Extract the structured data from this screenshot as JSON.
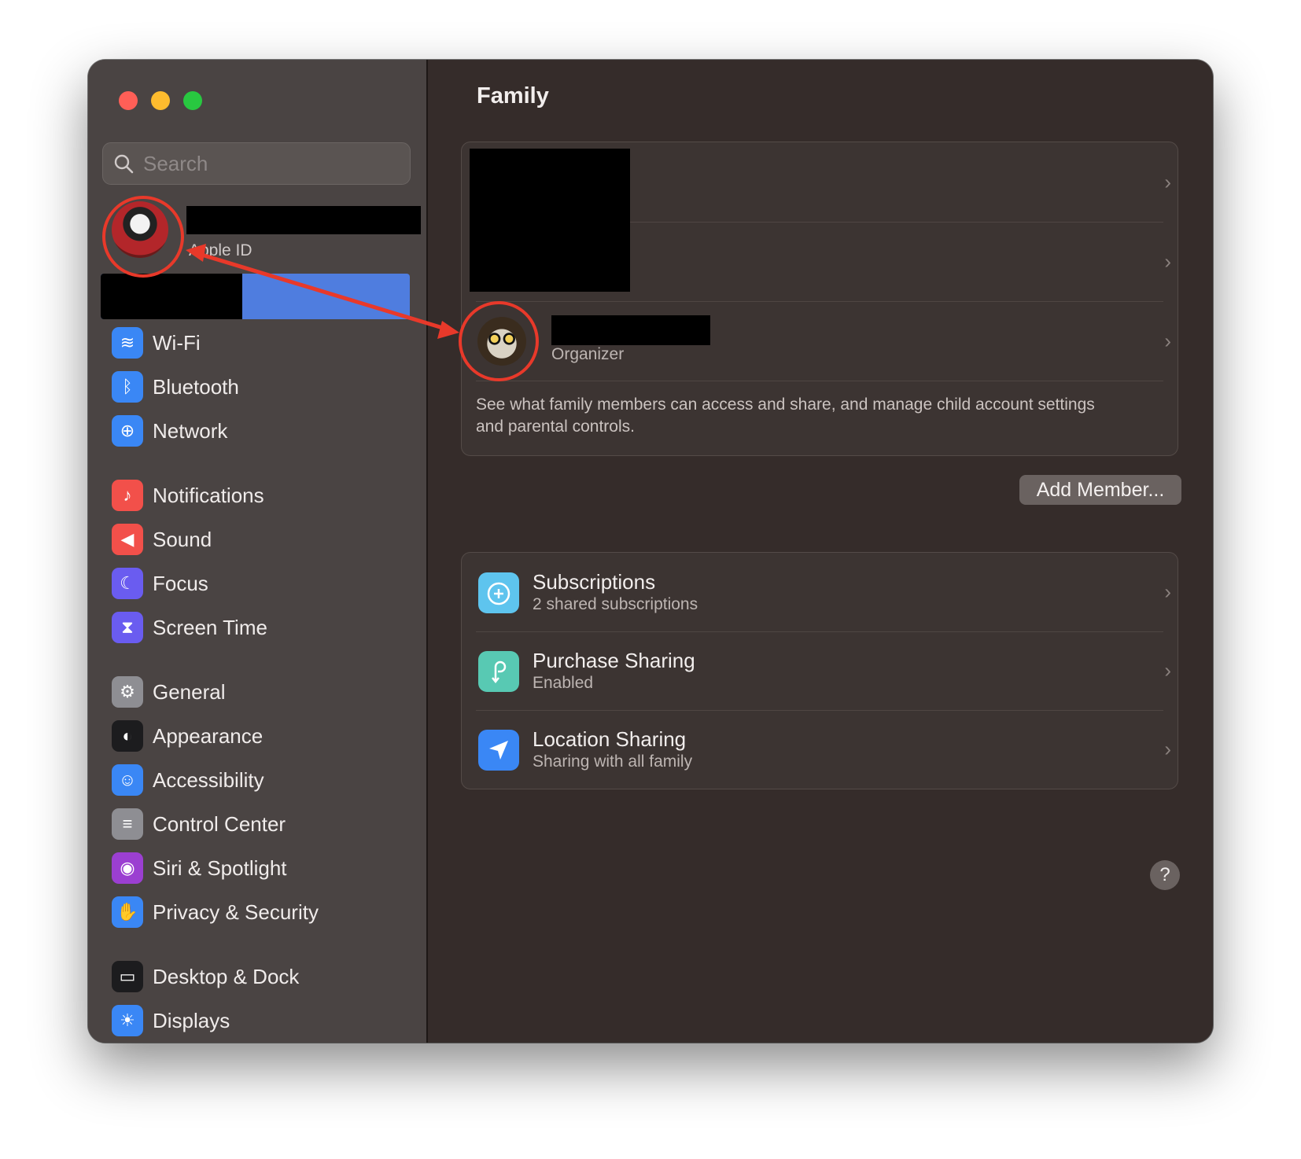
{
  "window": {
    "traffic_lights": [
      "close",
      "minimize",
      "maximize"
    ]
  },
  "search": {
    "placeholder": "Search"
  },
  "account": {
    "subtitle": "Apple ID"
  },
  "sidebar": {
    "items": [
      {
        "label": "Wi-Fi",
        "icon": "wifi-icon",
        "color": "#3a87f5"
      },
      {
        "label": "Bluetooth",
        "icon": "bluetooth-icon",
        "color": "#3a87f5"
      },
      {
        "label": "Network",
        "icon": "globe-icon",
        "color": "#3a87f5"
      },
      {
        "label": "Notifications",
        "icon": "bell-icon",
        "color": "#f2504a"
      },
      {
        "label": "Sound",
        "icon": "speaker-icon",
        "color": "#f2504a"
      },
      {
        "label": "Focus",
        "icon": "moon-icon",
        "color": "#6a5cf0"
      },
      {
        "label": "Screen Time",
        "icon": "hourglass-icon",
        "color": "#6a5cf0"
      },
      {
        "label": "General",
        "icon": "gear-icon",
        "color": "#8e8e93"
      },
      {
        "label": "Appearance",
        "icon": "appearance-icon",
        "color": "#1c1c1e"
      },
      {
        "label": "Accessibility",
        "icon": "accessibility-icon",
        "color": "#3a87f5"
      },
      {
        "label": "Control Center",
        "icon": "toggles-icon",
        "color": "#8e8e93"
      },
      {
        "label": "Siri & Spotlight",
        "icon": "siri-icon",
        "color": "#9b3fd1"
      },
      {
        "label": "Privacy & Security",
        "icon": "hand-icon",
        "color": "#3a87f5"
      },
      {
        "label": "Desktop & Dock",
        "icon": "dock-icon",
        "color": "#1c1c1e"
      },
      {
        "label": "Displays",
        "icon": "sun-icon",
        "color": "#3a87f5"
      }
    ]
  },
  "main": {
    "title": "Family",
    "organizer_label": "Organizer",
    "description": "See what family members can access and share, and manage child account settings and parental controls.",
    "add_member_label": "Add Member...",
    "services": [
      {
        "title": "Subscriptions",
        "subtitle": "2 shared subscriptions",
        "icon": "subscriptions-icon",
        "color": "#5ec4ee"
      },
      {
        "title": "Purchase Sharing",
        "subtitle": "Enabled",
        "icon": "purchase-sharing-icon",
        "color": "#58c9b3"
      },
      {
        "title": "Location Sharing",
        "subtitle": "Sharing with all family",
        "icon": "location-arrow-icon",
        "color": "#3a87f5"
      }
    ],
    "help_label": "?"
  },
  "chevron": "›"
}
